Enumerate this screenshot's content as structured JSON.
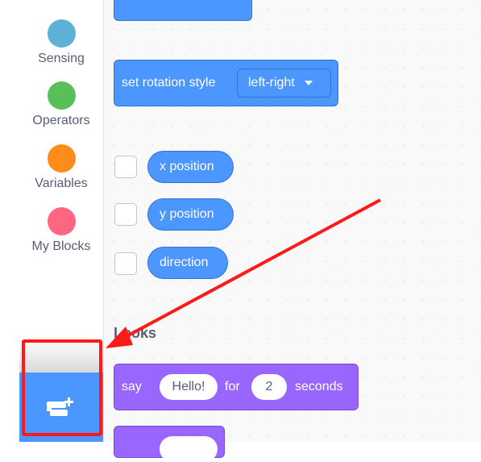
{
  "categories": [
    {
      "label": "Sensing",
      "color": "#5cb1d6"
    },
    {
      "label": "Operators",
      "color": "#59c059"
    },
    {
      "label": "Variables",
      "color": "#ff8c1a"
    },
    {
      "label": "My Blocks",
      "color": "#ff6680"
    }
  ],
  "extension_button": {
    "icon": "add-extension-icon",
    "color": "#4c97ff"
  },
  "motion": {
    "rotation_block": {
      "label": "set rotation style",
      "dropdown_value": "left-right"
    },
    "reporters": [
      {
        "label": "x position"
      },
      {
        "label": "y position"
      },
      {
        "label": "direction"
      }
    ]
  },
  "looks": {
    "title": "Looks",
    "say_block": {
      "say": "say",
      "message": "Hello!",
      "for": "for",
      "secs": "2",
      "seconds": "seconds"
    }
  },
  "annotation": {
    "color": "#ff1a1a"
  }
}
